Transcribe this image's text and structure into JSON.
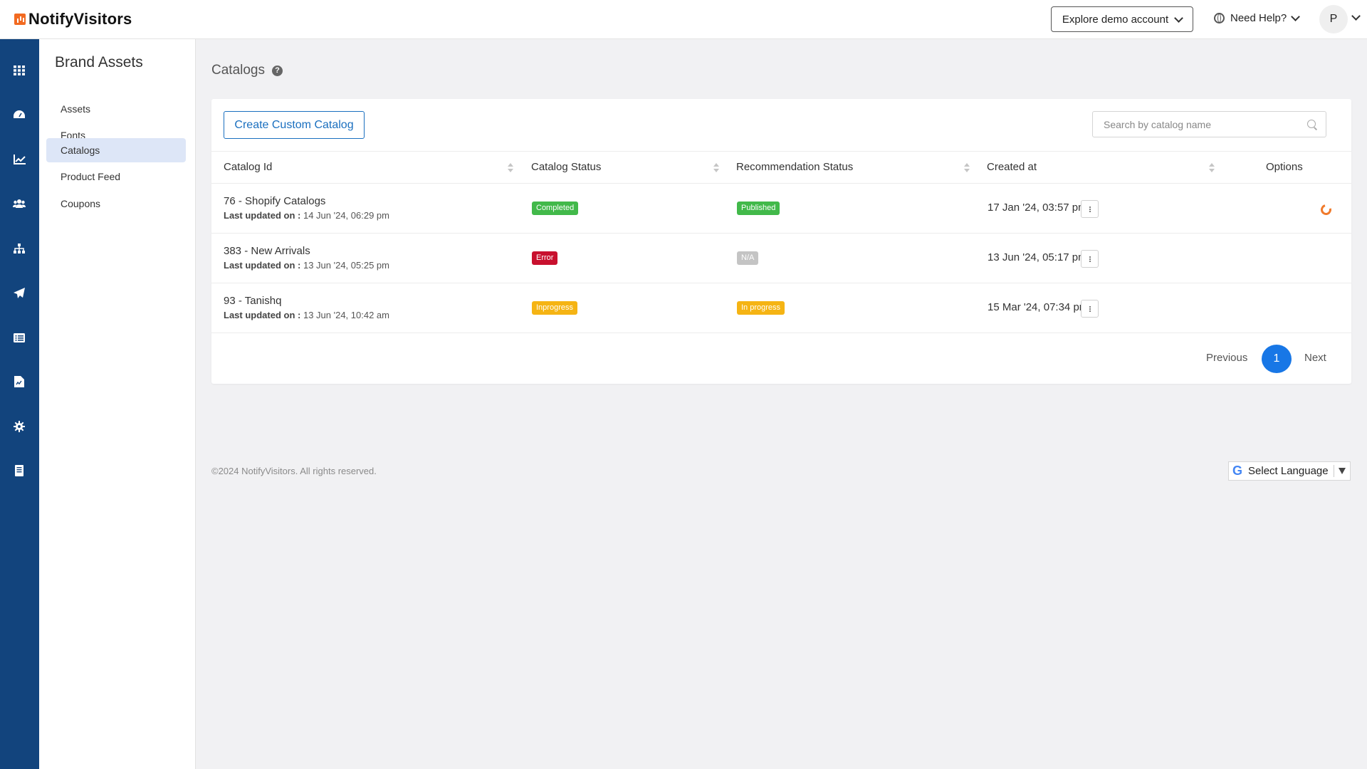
{
  "header": {
    "logo_text": "NotifyVisitors",
    "explore_label": "Explore demo account",
    "help_label": "Need Help?",
    "avatar_initial": "P"
  },
  "rail": {
    "icons": [
      "grid-icon",
      "dashboard-icon",
      "analytics-icon",
      "users-icon",
      "hierarchy-icon",
      "send-icon",
      "list-icon",
      "report-icon",
      "settings-icon",
      "document-icon"
    ]
  },
  "sidebar": {
    "title": "Brand Assets",
    "items": [
      {
        "label": "Assets"
      },
      {
        "label": "Fonts"
      },
      {
        "label": "Catalogs"
      },
      {
        "label": "Product Feed"
      },
      {
        "label": "Coupons"
      }
    ],
    "active": "Catalogs"
  },
  "page": {
    "title": "Catalogs"
  },
  "toolbar": {
    "create_label": "Create Custom Catalog",
    "search_placeholder": "Search by catalog name"
  },
  "table": {
    "columns": [
      "Catalog Id",
      "Catalog Status",
      "Recommendation Status",
      "Created at",
      "Options"
    ],
    "updated_prefix": "Last updated on :",
    "rows": [
      {
        "name": "76 - Shopify Catalogs",
        "updated": "14 Jun '24, 06:29 pm",
        "catalog_status": "Completed",
        "recommendation_status": "Published",
        "created_at": "17 Jan '24, 03:57 pm"
      },
      {
        "name": "383 - New Arrivals",
        "updated": "13 Jun '24, 05:25 pm",
        "catalog_status": "Error",
        "recommendation_status": "N/A",
        "created_at": "13 Jun '24, 05:17 pm"
      },
      {
        "name": "93 - Tanishq",
        "updated": "13 Jun '24, 10:42 am",
        "catalog_status": "Inprogress",
        "recommendation_status": "In progress",
        "created_at": "15 Mar '24, 07:34 pm"
      }
    ]
  },
  "pagination": {
    "previous_label": "Previous",
    "current_page": "1",
    "next_label": "Next"
  },
  "footer": {
    "copyright": "©2024 NotifyVisitors. All rights reserved.",
    "language_label": "Select Language"
  },
  "colors": {
    "rail": "#12447d",
    "accent": "#1877e6",
    "completed": "#42b94a",
    "error": "#c8102e",
    "na": "#c4c4c4",
    "inprogress": "#f5b414"
  }
}
